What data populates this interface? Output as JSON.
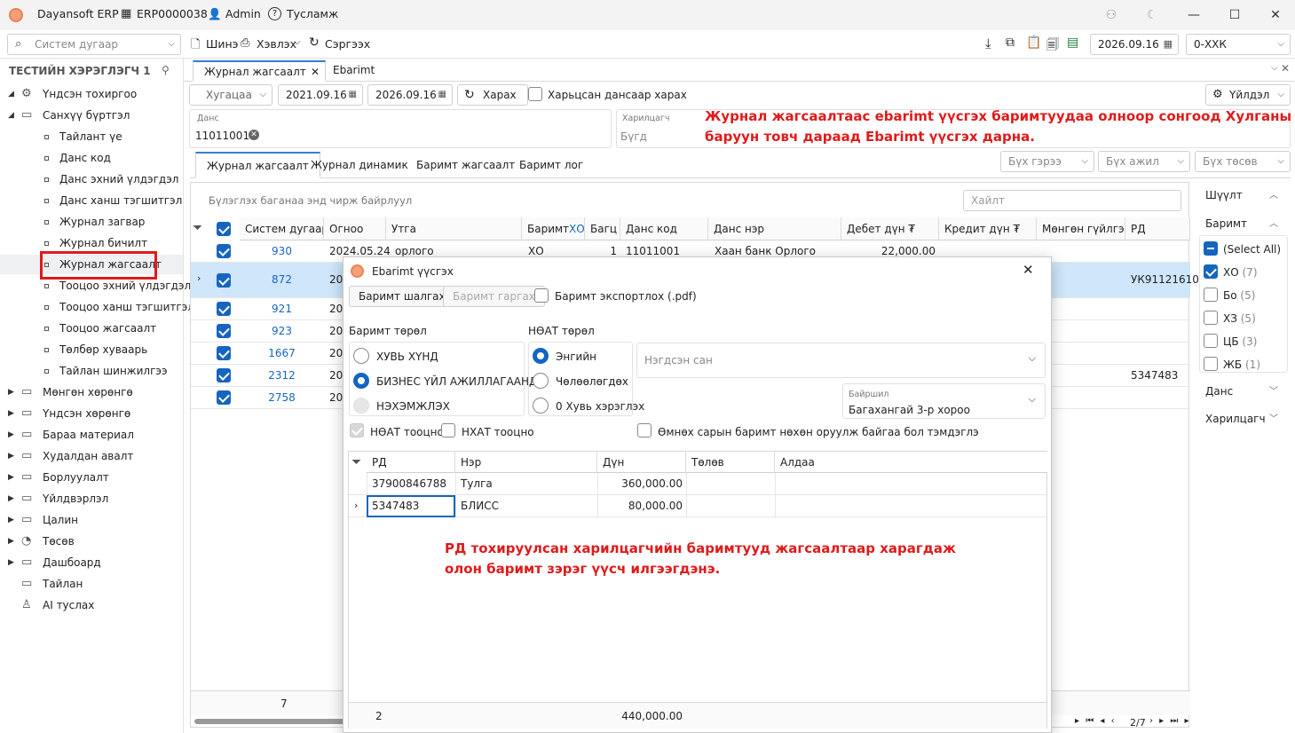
{
  "titlebar": {
    "app_name": "Dayansoft ERP",
    "company_code": "ERP0000038",
    "user": "Admin",
    "help": "Тусламж"
  },
  "toolbar": {
    "search_placeholder": "Систем дугаар",
    "new_label": "Шинэ",
    "print_label": "Хэвлэх",
    "refresh_label": "Сэргээх",
    "date": "2026.09.16",
    "branch": "0-ХХК"
  },
  "sidebar": {
    "user_title": "ТЕСТИЙН ХЭРЭГЛЭГЧ 1",
    "items": [
      {
        "label": "Үндсэн тохиргоо"
      },
      {
        "label": "Санхүү бүртгэл"
      },
      {
        "label": "Тайлант үе"
      },
      {
        "label": "Данс код"
      },
      {
        "label": "Данс эхний үлдэгдэл"
      },
      {
        "label": "Данс ханш тэгшитгэл"
      },
      {
        "label": "Журнал загвар"
      },
      {
        "label": "Журнал бичилт"
      },
      {
        "label": "Журнал жагсаалт"
      },
      {
        "label": "Тооцоо эхний үлдэгдэл"
      },
      {
        "label": "Тооцоо ханш тэгшитгэл"
      },
      {
        "label": "Тооцоо жагсаалт"
      },
      {
        "label": "Төлбөр хуваарь"
      },
      {
        "label": "Тайлан шинжилгээ"
      },
      {
        "label": "Мөнгөн хөрөнгө"
      },
      {
        "label": "Үндсэн хөрөнгө"
      },
      {
        "label": "Бараа материал"
      },
      {
        "label": "Худалдан авалт"
      },
      {
        "label": "Борлуулалт"
      },
      {
        "label": "Үйлдвэрлэл"
      },
      {
        "label": "Цалин"
      },
      {
        "label": "Төсөв"
      },
      {
        "label": "Дашбоард"
      },
      {
        "label": "Тайлан"
      },
      {
        "label": "AI туслах"
      }
    ]
  },
  "tabs": [
    {
      "label": "Журнал жагсаалт"
    },
    {
      "label": "Ebarimt"
    }
  ],
  "filters": {
    "period": "Хугацаа",
    "date_from": "2021.09.16",
    "date_to": "2026.09.16",
    "view_button": "Харах",
    "by_account_label": "Харьцсан дансаар харах",
    "action_button": "Үйлдэл",
    "account_label": "Данс",
    "account_value": "11011001",
    "partner_label": "Харилцагч",
    "partner_value": "Бүгд"
  },
  "annotations": {
    "top_line1": "Журнал жагсаалтаас ebarimt үүсгэх баримтуудаа олноор сонгоод Хулганы",
    "top_line2": "баруун товч дараад Ebarimt үүсгэх дарна.",
    "bottom_line1": "РД тохируулсан харилцагчийн баримтууд жагсаалтаар харагдаж",
    "bottom_line2": "олон баримт зэрэг үүсч илгээгдэнэ."
  },
  "subtabs": [
    {
      "label": "Журнал жагсаалт"
    },
    {
      "label": "Журнал динамик"
    },
    {
      "label": "Баримт жагсаалт"
    },
    {
      "label": "Баримт лог"
    }
  ],
  "subfilters": {
    "contract": "Бүх гэрээ",
    "job": "Бүх ажил",
    "budget": "Бүх төсөв"
  },
  "grid": {
    "group_hint": "Бүлэглэх баганаа энд чирж байрлуул",
    "search_placeholder": "Хайлт",
    "columns": [
      "Систем дугаар",
      "Огноо",
      "Утга",
      "Баримт",
      "ХО",
      "Багц",
      "Данс код",
      "Данс нэр",
      "Дебет дүн ₮",
      "Кредит дүн ₮",
      "Мөнгөн гүйлгээ",
      "РД"
    ],
    "rows": [
      {
        "sys": "930",
        "date": "2024.05.24",
        "desc": "орлого",
        "doc": "ХО",
        "batch": "1",
        "acc": "11011001",
        "accname": "Хаан банк Орлого",
        "debit": "22,000.00",
        "rd": ""
      },
      {
        "sys": "872",
        "date": "20",
        "rd": "УК91121610"
      },
      {
        "sys": "921",
        "date": "20",
        "rd": ""
      },
      {
        "sys": "923",
        "date": "20",
        "rd": ""
      },
      {
        "sys": "1667",
        "date": "20",
        "rd": ""
      },
      {
        "sys": "2312",
        "date": "20",
        "rd": "5347483"
      },
      {
        "sys": "2758",
        "date": "20",
        "rd": ""
      }
    ],
    "footer_count": "7",
    "pager": "2/7"
  },
  "right_panel": {
    "filter_title": "Шүүлт",
    "doc_title": "Баримт",
    "options": [
      {
        "label": "(Select All)",
        "count": ""
      },
      {
        "label": "ХО",
        "count": "(7)"
      },
      {
        "label": "Бо",
        "count": "(5)"
      },
      {
        "label": "ХЗ",
        "count": "(5)"
      },
      {
        "label": "ЦБ",
        "count": "(3)"
      },
      {
        "label": "ЖБ",
        "count": "(1)"
      }
    ],
    "account_title": "Данс",
    "partner_title": "Харилцагч"
  },
  "dialog": {
    "title": "Ebarimt үүсгэх",
    "check_button": "Баримт шалгах",
    "issue_button": "Баримт гаргах",
    "export_pdf": "Баримт экспортлох (.pdf)",
    "doc_type_label": "Баримт төрөл",
    "doc_types": [
      "ХУВЬ ХҮНД",
      "БИЗНЕС ҮЙЛ АЖИЛЛАГААНД",
      "НЭХЭМЖЛЭХ"
    ],
    "vat_type_label": "НӨАТ төрөл",
    "vat_types": [
      "Энгийн",
      "Чөлөөлөгдөх",
      "0 Хувь хэрэглэх"
    ],
    "fund_placeholder": "Нэгдсэн сан",
    "location_label": "Байршил",
    "location_value": "Багахангай 3-р хороо",
    "vat_calc": "НӨАТ тооцно",
    "nhat_calc": "НХАТ тооцно",
    "prev_month_note": "Өмнөх сарын баримт нөхөн оруулж байгаа бол тэмдэглэ",
    "columns": [
      "РД",
      "Нэр",
      "Дүн",
      "Төлөв",
      "Алдаа"
    ],
    "rows": [
      {
        "rd": "37900846788",
        "name": "Тулга",
        "amount": "360,000.00",
        "status": "",
        "error": ""
      },
      {
        "rd": "5347483",
        "name": "БЛИСС",
        "amount": "80,000.00",
        "status": "",
        "error": ""
      }
    ],
    "footer_count": "2",
    "footer_total": "440,000.00"
  }
}
